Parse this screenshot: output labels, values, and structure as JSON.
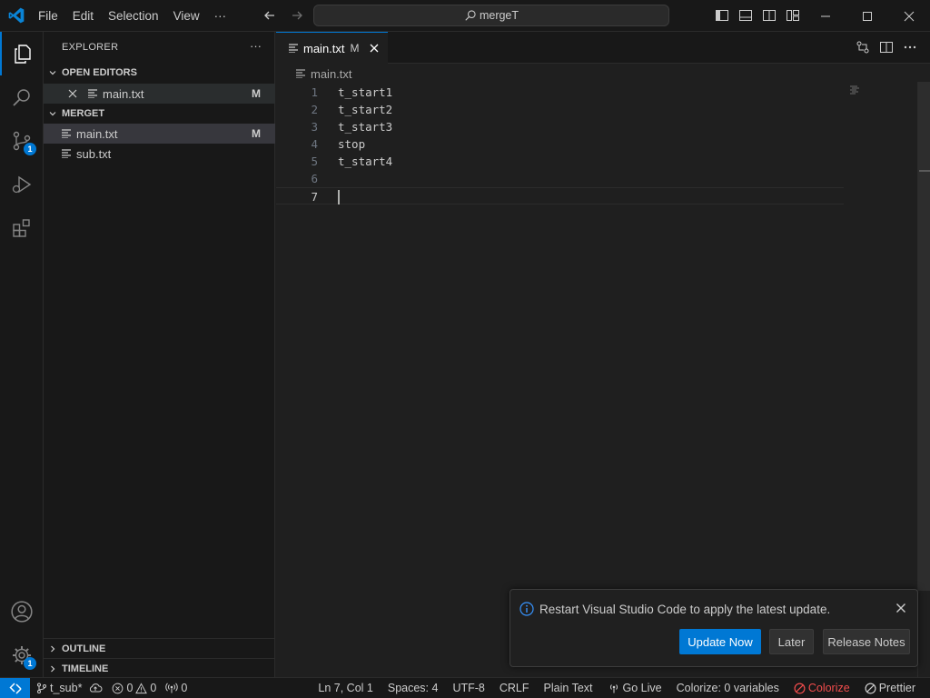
{
  "titlebar": {
    "menu": [
      "File",
      "Edit",
      "Selection",
      "View",
      "···"
    ],
    "search": "mergeT"
  },
  "activity": {
    "scm_badge": "1",
    "settings_badge": "1"
  },
  "sidebar": {
    "title": "EXPLORER",
    "more": "···",
    "open_editors": {
      "label": "OPEN EDITORS",
      "items": [
        {
          "name": "main.txt",
          "status": "M"
        }
      ]
    },
    "folder": {
      "label": "MERGET",
      "items": [
        {
          "name": "main.txt",
          "status": "M"
        },
        {
          "name": "sub.txt",
          "status": ""
        }
      ]
    },
    "outline": "OUTLINE",
    "timeline": "TIMELINE"
  },
  "editor": {
    "tab": {
      "name": "main.txt",
      "status": "M"
    },
    "breadcrumb": "main.txt",
    "lines": [
      {
        "num": "1",
        "text": "t_start1"
      },
      {
        "num": "2",
        "text": "t_start2"
      },
      {
        "num": "3",
        "text": "t_start3"
      },
      {
        "num": "4",
        "text": "stop"
      },
      {
        "num": "5",
        "text": "t_start4"
      },
      {
        "num": "6",
        "text": ""
      },
      {
        "num": "7",
        "text": ""
      }
    ]
  },
  "notification": {
    "message": "Restart Visual Studio Code to apply the latest update.",
    "primary": "Update Now",
    "later": "Later",
    "notes": "Release Notes"
  },
  "statusbar": {
    "branch": "t_sub*",
    "errors": "0",
    "warnings": "0",
    "ports": "0",
    "position": "Ln 7, Col 1",
    "spaces": "Spaces: 4",
    "encoding": "UTF-8",
    "eol": "CRLF",
    "language": "Plain Text",
    "golive": "Go Live",
    "colorize_vars": "Colorize: 0 variables",
    "colorize": "Colorize",
    "prettier": "Prettier"
  },
  "colors": {
    "accent": "#0078d4",
    "background": "#1f1f1f",
    "sidebar": "#181818",
    "error": "#f14c4c"
  }
}
